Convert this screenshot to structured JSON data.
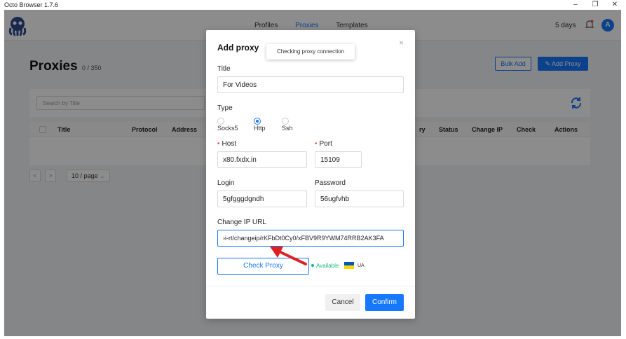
{
  "window": {
    "title": "Octo Browser 1.7.6",
    "minimize": "–",
    "restore": "❐",
    "close": "✕"
  },
  "nav": {
    "items": [
      "Profiles",
      "Proxies",
      "Templates"
    ],
    "active": "Proxies",
    "days": "5 days",
    "avatar_letter": "A"
  },
  "page": {
    "title": "Proxies",
    "count": "0 / 350",
    "bulk_add": "Bulk Add",
    "add_proxy": "Add Proxy",
    "search_placeholder": "Search by Title"
  },
  "table": {
    "columns": [
      "Title",
      "Protocol",
      "Address",
      "ry",
      "Status",
      "Change IP",
      "Check",
      "Actions"
    ]
  },
  "pagination": {
    "prev": "<",
    "next": ">",
    "page_size": "10 / page"
  },
  "modal": {
    "title": "Add proxy",
    "close": "×",
    "tooltip": "Checking proxy connection",
    "title_label": "Title",
    "title_value": "For Videos",
    "type_label": "Type",
    "types": [
      "Socks5",
      "Http",
      "Ssh"
    ],
    "type_selected": "Http",
    "host_label": "Host",
    "host_value": "x80.fxdx.in",
    "port_label": "Port",
    "port_value": "15109",
    "login_label": "Login",
    "login_value": "5gfgggdgndh",
    "password_label": "Password",
    "password_value": "56ugfvhb",
    "change_ip_label": "Change IP URL",
    "change_ip_value": "›i-rt/changeip/rKFbDt0Cy0/xFBV9R9YWM74RRB2AK3FA",
    "check_button": "Check Proxy",
    "status": "Available",
    "country": "UA",
    "cancel": "Cancel",
    "confirm": "Confirm"
  },
  "colors": {
    "accent": "#1677ff",
    "available": "#10b981",
    "arrow": "#e02020"
  }
}
